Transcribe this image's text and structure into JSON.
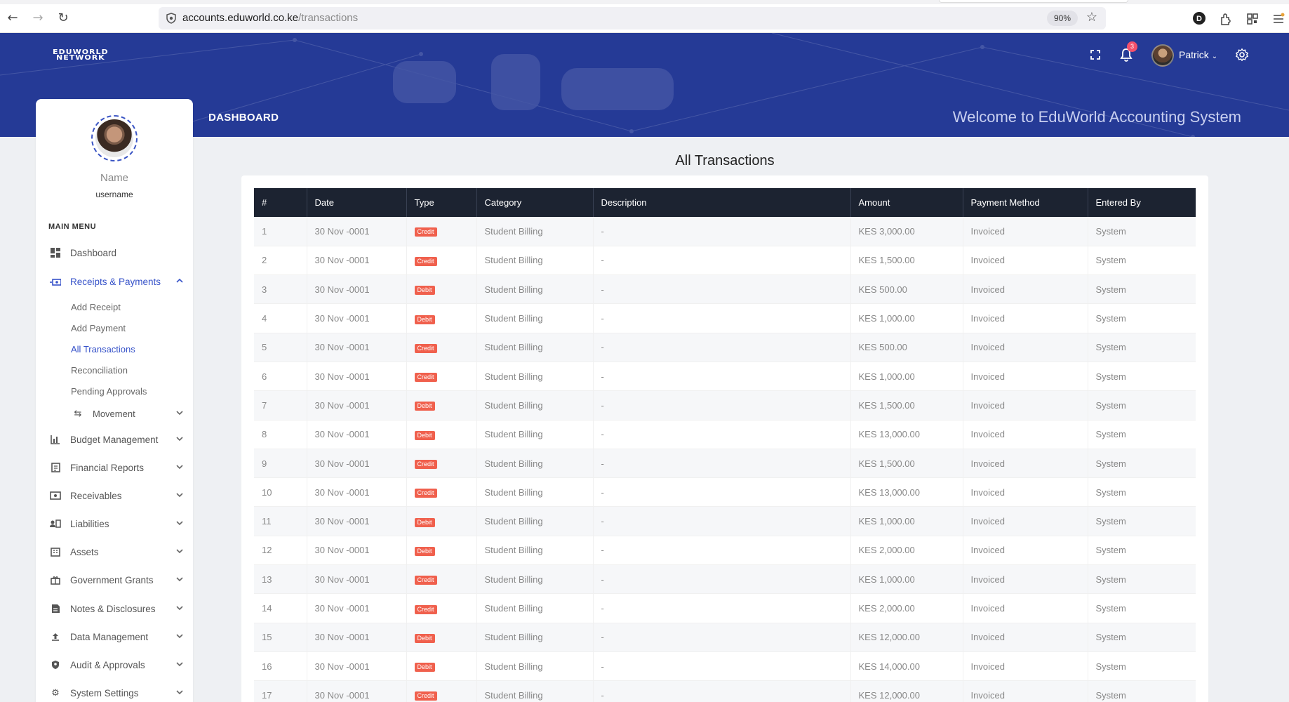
{
  "browser": {
    "url_domain": "accounts.eduworld.co.ke",
    "url_path": "/transactions",
    "zoom": "90%",
    "profile_initial": "D"
  },
  "header": {
    "logo_line1": "EDUWORLD",
    "logo_line2": "NETWORK",
    "notification_count": "3",
    "user_name": "Patrick",
    "page_title": "DASHBOARD",
    "welcome": "Welcome to EduWorld Accounting System"
  },
  "sidebar": {
    "name": "Name",
    "username": "username",
    "main_menu": "MAIN MENU",
    "items": [
      {
        "label": "Dashboard",
        "icon": "dashboard-icon"
      },
      {
        "label": "Receipts & Payments",
        "icon": "cash-icon"
      },
      {
        "label": "Budget Management",
        "icon": "bar-chart-icon"
      },
      {
        "label": "Financial Reports",
        "icon": "report-icon"
      },
      {
        "label": "Receivables",
        "icon": "money-icon"
      },
      {
        "label": "Liabilities",
        "icon": "contact-card-icon"
      },
      {
        "label": "Assets",
        "icon": "building-icon"
      },
      {
        "label": "Government Grants",
        "icon": "gift-icon"
      },
      {
        "label": "Notes & Disclosures",
        "icon": "note-icon"
      },
      {
        "label": "Data Management",
        "icon": "upload-icon"
      },
      {
        "label": "Audit & Approvals",
        "icon": "shield-check-icon"
      },
      {
        "label": "System Settings",
        "icon": "cogs-icon"
      }
    ],
    "sub_items": [
      "Add Receipt",
      "Add Payment",
      "All Transactions",
      "Reconciliation",
      "Pending Approvals",
      "Movement"
    ]
  },
  "main": {
    "title": "All Transactions",
    "columns": [
      "#",
      "Date",
      "Type",
      "Category",
      "Description",
      "Amount",
      "Payment Method",
      "Entered By"
    ],
    "rows": [
      [
        "1",
        "30 Nov -0001",
        "Credit",
        "Student Billing",
        "-",
        "KES 3,000.00",
        "Invoiced",
        "System"
      ],
      [
        "2",
        "30 Nov -0001",
        "Credit",
        "Student Billing",
        "-",
        "KES 1,500.00",
        "Invoiced",
        "System"
      ],
      [
        "3",
        "30 Nov -0001",
        "Debit",
        "Student Billing",
        "-",
        "KES 500.00",
        "Invoiced",
        "System"
      ],
      [
        "4",
        "30 Nov -0001",
        "Debit",
        "Student Billing",
        "-",
        "KES 1,000.00",
        "Invoiced",
        "System"
      ],
      [
        "5",
        "30 Nov -0001",
        "Credit",
        "Student Billing",
        "-",
        "KES 500.00",
        "Invoiced",
        "System"
      ],
      [
        "6",
        "30 Nov -0001",
        "Credit",
        "Student Billing",
        "-",
        "KES 1,000.00",
        "Invoiced",
        "System"
      ],
      [
        "7",
        "30 Nov -0001",
        "Debit",
        "Student Billing",
        "-",
        "KES 1,500.00",
        "Invoiced",
        "System"
      ],
      [
        "8",
        "30 Nov -0001",
        "Debit",
        "Student Billing",
        "-",
        "KES 13,000.00",
        "Invoiced",
        "System"
      ],
      [
        "9",
        "30 Nov -0001",
        "Credit",
        "Student Billing",
        "-",
        "KES 1,500.00",
        "Invoiced",
        "System"
      ],
      [
        "10",
        "30 Nov -0001",
        "Credit",
        "Student Billing",
        "-",
        "KES 13,000.00",
        "Invoiced",
        "System"
      ],
      [
        "11",
        "30 Nov -0001",
        "Debit",
        "Student Billing",
        "-",
        "KES 1,000.00",
        "Invoiced",
        "System"
      ],
      [
        "12",
        "30 Nov -0001",
        "Debit",
        "Student Billing",
        "-",
        "KES 2,000.00",
        "Invoiced",
        "System"
      ],
      [
        "13",
        "30 Nov -0001",
        "Credit",
        "Student Billing",
        "-",
        "KES 1,000.00",
        "Invoiced",
        "System"
      ],
      [
        "14",
        "30 Nov -0001",
        "Credit",
        "Student Billing",
        "-",
        "KES 2,000.00",
        "Invoiced",
        "System"
      ],
      [
        "15",
        "30 Nov -0001",
        "Debit",
        "Student Billing",
        "-",
        "KES 12,000.00",
        "Invoiced",
        "System"
      ],
      [
        "16",
        "30 Nov -0001",
        "Debit",
        "Student Billing",
        "-",
        "KES 14,000.00",
        "Invoiced",
        "System"
      ],
      [
        "17",
        "30 Nov -0001",
        "Credit",
        "Student Billing",
        "-",
        "KES 12,000.00",
        "Invoiced",
        "System"
      ]
    ]
  },
  "colors": {
    "header_bg": "#253a96",
    "accent": "#3652c9",
    "table_header": "#1c2331",
    "type_badge": "#f0604d"
  }
}
